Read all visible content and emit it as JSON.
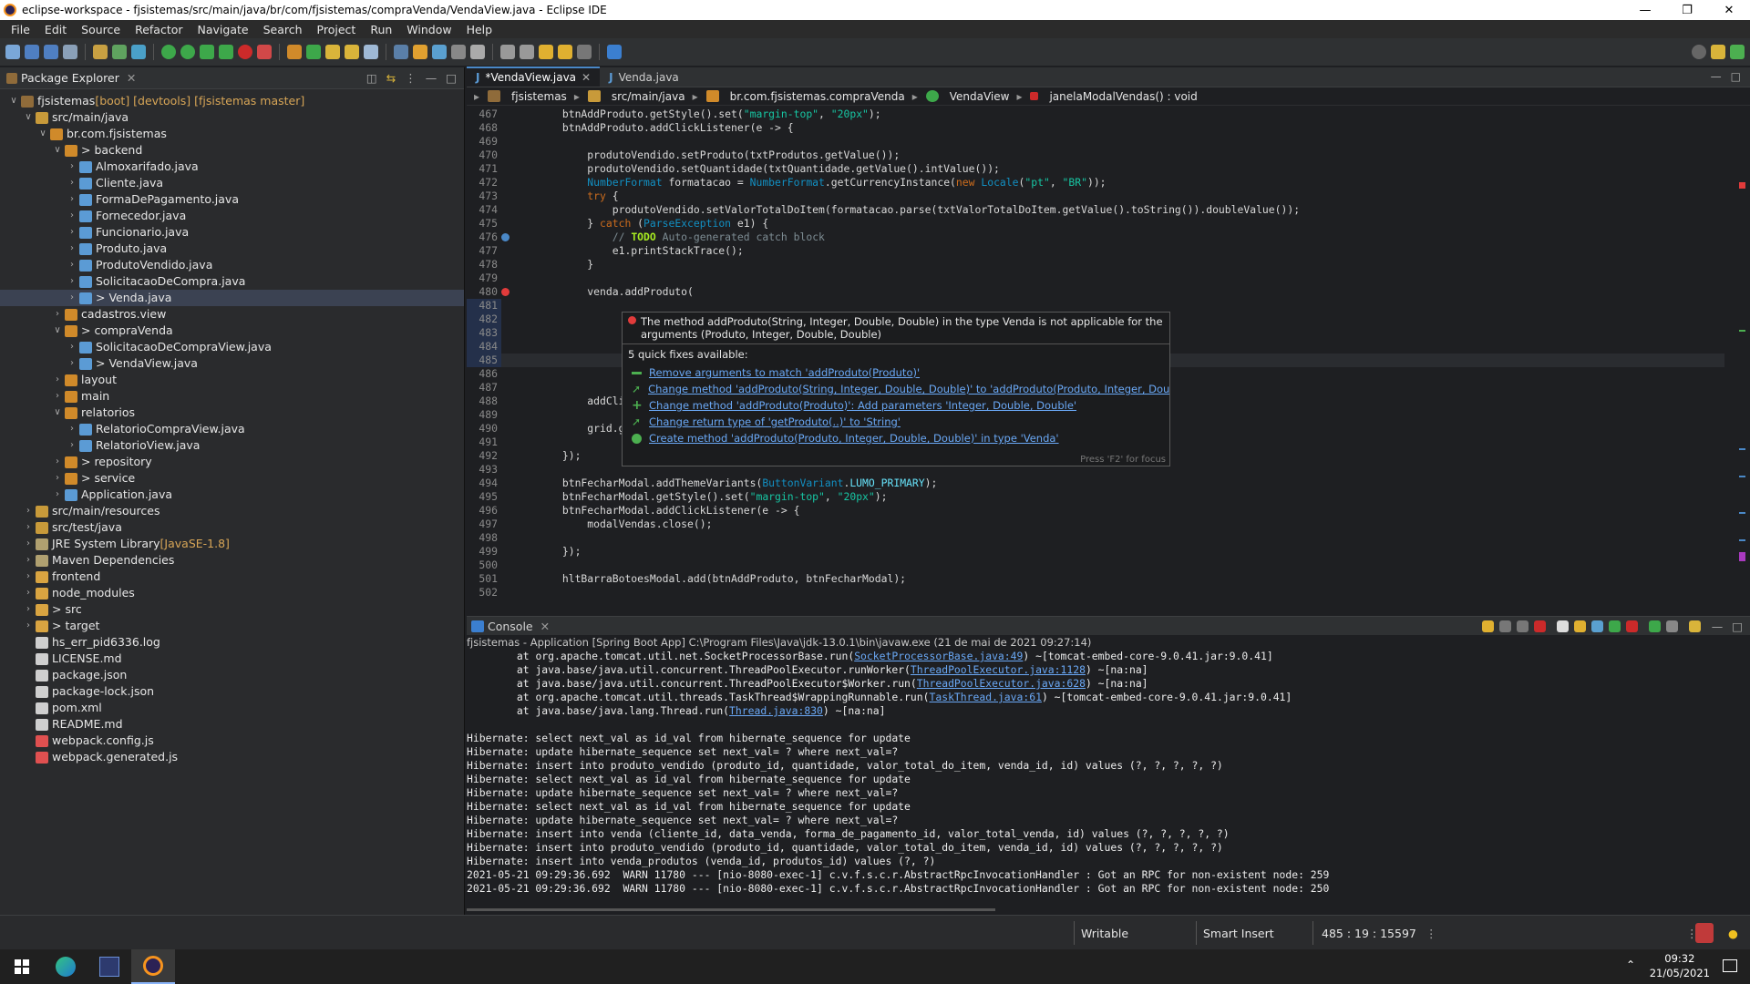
{
  "window": {
    "title": "eclipse-workspace - fjsistemas/src/main/java/br/com/fjsistemas/compraVenda/VendaView.java - Eclipse IDE"
  },
  "menu": [
    "File",
    "Edit",
    "Source",
    "Refactor",
    "Navigate",
    "Search",
    "Project",
    "Run",
    "Window",
    "Help"
  ],
  "explorer": {
    "title": "Package Explorer",
    "rows": [
      {
        "indent": 0,
        "arrow": "v",
        "icon": "project",
        "label": "fjsistemas",
        "deco": " [boot] [devtools] [fjsistemas master]"
      },
      {
        "indent": 1,
        "arrow": "v",
        "icon": "srcfolder",
        "label": "src/main/java",
        "deco": ""
      },
      {
        "indent": 2,
        "arrow": "v",
        "icon": "package",
        "label": "br.com.fjsistemas",
        "deco": ""
      },
      {
        "indent": 3,
        "arrow": "v",
        "icon": "package",
        "label": "> backend",
        "deco": ""
      },
      {
        "indent": 4,
        "arrow": ">",
        "icon": "java",
        "label": "Almoxarifado.java",
        "deco": ""
      },
      {
        "indent": 4,
        "arrow": ">",
        "icon": "java",
        "label": "Cliente.java",
        "deco": ""
      },
      {
        "indent": 4,
        "arrow": ">",
        "icon": "java",
        "label": "FormaDePagamento.java",
        "deco": ""
      },
      {
        "indent": 4,
        "arrow": ">",
        "icon": "java",
        "label": "Fornecedor.java",
        "deco": ""
      },
      {
        "indent": 4,
        "arrow": ">",
        "icon": "java",
        "label": "Funcionario.java",
        "deco": ""
      },
      {
        "indent": 4,
        "arrow": ">",
        "icon": "java",
        "label": "Produto.java",
        "deco": ""
      },
      {
        "indent": 4,
        "arrow": ">",
        "icon": "java",
        "label": "ProdutoVendido.java",
        "deco": ""
      },
      {
        "indent": 4,
        "arrow": ">",
        "icon": "java",
        "label": "SolicitacaoDeCompra.java",
        "deco": ""
      },
      {
        "indent": 4,
        "arrow": ">",
        "icon": "java",
        "label": "> Venda.java",
        "deco": "",
        "selected": true
      },
      {
        "indent": 3,
        "arrow": ">",
        "icon": "package",
        "label": "cadastros.view",
        "deco": ""
      },
      {
        "indent": 3,
        "arrow": "v",
        "icon": "package",
        "label": "> compraVenda",
        "deco": ""
      },
      {
        "indent": 4,
        "arrow": ">",
        "icon": "java",
        "label": "SolicitacaoDeCompraView.java",
        "deco": ""
      },
      {
        "indent": 4,
        "arrow": ">",
        "icon": "java",
        "label": "> VendaView.java",
        "deco": ""
      },
      {
        "indent": 3,
        "arrow": ">",
        "icon": "package",
        "label": "layout",
        "deco": ""
      },
      {
        "indent": 3,
        "arrow": ">",
        "icon": "package",
        "label": "main",
        "deco": ""
      },
      {
        "indent": 3,
        "arrow": "v",
        "icon": "package",
        "label": "relatorios",
        "deco": ""
      },
      {
        "indent": 4,
        "arrow": ">",
        "icon": "java",
        "label": "RelatorioCompraView.java",
        "deco": ""
      },
      {
        "indent": 4,
        "arrow": ">",
        "icon": "java",
        "label": "RelatorioView.java",
        "deco": ""
      },
      {
        "indent": 3,
        "arrow": ">",
        "icon": "package",
        "label": "> repository",
        "deco": ""
      },
      {
        "indent": 3,
        "arrow": ">",
        "icon": "package",
        "label": "> service",
        "deco": ""
      },
      {
        "indent": 3,
        "arrow": ">",
        "icon": "java",
        "label": "Application.java",
        "deco": ""
      },
      {
        "indent": 1,
        "arrow": ">",
        "icon": "srcfolder",
        "label": "src/main/resources",
        "deco": ""
      },
      {
        "indent": 1,
        "arrow": ">",
        "icon": "srcfolder",
        "label": "src/test/java",
        "deco": ""
      },
      {
        "indent": 1,
        "arrow": ">",
        "icon": "library",
        "label": "JRE System Library",
        "deco": " [JavaSE-1.8]"
      },
      {
        "indent": 1,
        "arrow": ">",
        "icon": "library",
        "label": "Maven Dependencies",
        "deco": ""
      },
      {
        "indent": 1,
        "arrow": ">",
        "icon": "folder",
        "label": "frontend",
        "deco": ""
      },
      {
        "indent": 1,
        "arrow": ">",
        "icon": "folder",
        "label": "node_modules",
        "deco": ""
      },
      {
        "indent": 1,
        "arrow": ">",
        "icon": "folder",
        "label": "> src",
        "deco": ""
      },
      {
        "indent": 1,
        "arrow": ">",
        "icon": "folder",
        "label": "> target",
        "deco": ""
      },
      {
        "indent": 1,
        "arrow": "",
        "icon": "file",
        "label": "hs_err_pid6336.log",
        "deco": ""
      },
      {
        "indent": 1,
        "arrow": "",
        "icon": "file",
        "label": "LICENSE.md",
        "deco": ""
      },
      {
        "indent": 1,
        "arrow": "",
        "icon": "file",
        "label": "package.json",
        "deco": ""
      },
      {
        "indent": 1,
        "arrow": "",
        "icon": "file",
        "label": "package-lock.json",
        "deco": ""
      },
      {
        "indent": 1,
        "arrow": "",
        "icon": "file",
        "label": "pom.xml",
        "deco": ""
      },
      {
        "indent": 1,
        "arrow": "",
        "icon": "file",
        "label": "README.md",
        "deco": ""
      },
      {
        "indent": 1,
        "arrow": "",
        "icon": "webfile",
        "label": "webpack.config.js",
        "deco": ""
      },
      {
        "indent": 1,
        "arrow": "",
        "icon": "webfile",
        "label": "webpack.generated.js",
        "deco": ""
      }
    ]
  },
  "editor": {
    "tabs": [
      {
        "label": "*VendaView.java",
        "active": true
      },
      {
        "label": "Venda.java",
        "active": false
      }
    ],
    "breadcrumb": [
      "fjsistemas",
      "src/main/java",
      "br.com.fjsistemas.compraVenda",
      "VendaView",
      "janelaModalVendas() : void"
    ],
    "lines": [
      {
        "n": "467",
        "t": "        btnAddProduto.getStyle().set(\"margin-top\", \"20px\");"
      },
      {
        "n": "468",
        "t": "        btnAddProduto.addClickListener(e -> {"
      },
      {
        "n": "469",
        "t": ""
      },
      {
        "n": "470",
        "t": "            produtoVendido.setProduto(txtProdutos.getValue());"
      },
      {
        "n": "471",
        "t": "            produtoVendido.setQuantidade(txtQuantidade.getValue().intValue());"
      },
      {
        "n": "472",
        "t": "            NumberFormat formatacao = NumberFormat.getCurrencyInstance(new Locale(\"pt\", \"BR\"));"
      },
      {
        "n": "473",
        "t": "            try {"
      },
      {
        "n": "474",
        "t": "                produtoVendido.setValorTotalDoItem(formatacao.parse(txtValorTotalDoItem.getValue().toString()).doubleValue());"
      },
      {
        "n": "475",
        "t": "            } catch (ParseException e1) {"
      },
      {
        "n": "476",
        "t": "                // TODO Auto-generated catch block"
      },
      {
        "n": "477",
        "t": "                e1.printStackTrace();"
      },
      {
        "n": "478",
        "t": "            }"
      },
      {
        "n": "479",
        "t": ""
      },
      {
        "n": "480",
        "t": "            venda.addProduto("
      },
      {
        "n": "481",
        "t": ""
      },
      {
        "n": "482",
        "t": ""
      },
      {
        "n": "483",
        "t": ""
      },
      {
        "n": "484",
        "t": ""
      },
      {
        "n": "485",
        "t": "                    );"
      },
      {
        "n": "486",
        "t": ""
      },
      {
        "n": "487",
        "t": ""
      },
      {
        "n": "488",
        "t": "            addCli"
      },
      {
        "n": "489",
        "t": ""
      },
      {
        "n": "490",
        "t": "            grid.g"
      },
      {
        "n": "491",
        "t": ""
      },
      {
        "n": "492",
        "t": "        });"
      },
      {
        "n": "493",
        "t": ""
      },
      {
        "n": "494",
        "t": "        btnFecharModal.addThemeVariants(ButtonVariant.LUMO_PRIMARY);"
      },
      {
        "n": "495",
        "t": "        btnFecharModal.getStyle().set(\"margin-top\", \"20px\");"
      },
      {
        "n": "496",
        "t": "        btnFecharModal.addClickListener(e -> {"
      },
      {
        "n": "497",
        "t": "            modalVendas.close();"
      },
      {
        "n": "498",
        "t": ""
      },
      {
        "n": "499",
        "t": "        });"
      },
      {
        "n": "500",
        "t": ""
      },
      {
        "n": "501",
        "t": "        hltBarraBotoesModal.add(btnAddProduto, btnFecharModal);"
      },
      {
        "n": "502",
        "t": ""
      }
    ]
  },
  "popup": {
    "message": "The method addProduto(String, Integer, Double, Double) in the type Venda is not applicable for the arguments (Produto, Integer, Double, Double)",
    "header": "5 quick fixes available:",
    "fixes": [
      {
        "icon": "remove",
        "label": "Remove arguments to match 'addProduto(Produto)'"
      },
      {
        "icon": "change",
        "label": "Change method 'addProduto(String, Integer, Double, Double)' to 'addProduto(Produto, Integer, Double, Double)'"
      },
      {
        "icon": "add",
        "label": "Change method 'addProduto(Produto)': Add parameters 'Integer, Double, Double'"
      },
      {
        "icon": "change",
        "label": "Change return type of 'getProduto(..)' to 'String'"
      },
      {
        "icon": "create",
        "label": "Create method 'addProduto(Produto, Integer, Double, Double)' in type 'Venda'"
      }
    ],
    "footer": "Press 'F2' for focus"
  },
  "console": {
    "title": "Console",
    "description": "fjsistemas - Application [Spring Boot App] C:\\Program Files\\Java\\jdk-13.0.1\\bin\\javaw.exe  (21 de mai de 2021 09:27:14)",
    "lines": [
      {
        "pre": "\tat org.apache.tomcat.util.net.SocketProcessorBase.run(",
        "link": "SocketProcessorBase.java:49",
        "post": ") ~[tomcat-embed-core-9.0.41.jar:9.0.41]"
      },
      {
        "pre": "\tat java.base/java.util.concurrent.ThreadPoolExecutor.runWorker(",
        "link": "ThreadPoolExecutor.java:1128",
        "post": ") ~[na:na]"
      },
      {
        "pre": "\tat java.base/java.util.concurrent.ThreadPoolExecutor$Worker.run(",
        "link": "ThreadPoolExecutor.java:628",
        "post": ") ~[na:na]"
      },
      {
        "pre": "\tat org.apache.tomcat.util.threads.TaskThread$WrappingRunnable.run(",
        "link": "TaskThread.java:61",
        "post": ") ~[tomcat-embed-core-9.0.41.jar:9.0.41]"
      },
      {
        "pre": "\tat java.base/java.lang.Thread.run(",
        "link": "Thread.java:830",
        "post": ") ~[na:na]"
      },
      {
        "pre": "",
        "link": "",
        "post": ""
      },
      {
        "pre": "Hibernate: select next_val as id_val from hibernate_sequence for update",
        "link": "",
        "post": ""
      },
      {
        "pre": "Hibernate: update hibernate_sequence set next_val= ? where next_val=?",
        "link": "",
        "post": ""
      },
      {
        "pre": "Hibernate: insert into produto_vendido (produto_id, quantidade, valor_total_do_item, venda_id, id) values (?, ?, ?, ?, ?)",
        "link": "",
        "post": ""
      },
      {
        "pre": "Hibernate: select next_val as id_val from hibernate_sequence for update",
        "link": "",
        "post": ""
      },
      {
        "pre": "Hibernate: update hibernate_sequence set next_val= ? where next_val=?",
        "link": "",
        "post": ""
      },
      {
        "pre": "Hibernate: select next_val as id_val from hibernate_sequence for update",
        "link": "",
        "post": ""
      },
      {
        "pre": "Hibernate: update hibernate_sequence set next_val= ? where next_val=?",
        "link": "",
        "post": ""
      },
      {
        "pre": "Hibernate: insert into venda (cliente_id, data_venda, forma_de_pagamento_id, valor_total_venda, id) values (?, ?, ?, ?, ?)",
        "link": "",
        "post": ""
      },
      {
        "pre": "Hibernate: insert into produto_vendido (produto_id, quantidade, valor_total_do_item, venda_id, id) values (?, ?, ?, ?, ?)",
        "link": "",
        "post": ""
      },
      {
        "pre": "Hibernate: insert into venda_produtos (venda_id, produtos_id) values (?, ?)",
        "link": "",
        "post": ""
      },
      {
        "pre": "2021-05-21 09:29:36.692  WARN 11780 --- [nio-8080-exec-1] c.v.f.s.c.r.AbstractRpcInvocationHandler : Got an RPC for non-existent node: 259",
        "link": "",
        "post": ""
      },
      {
        "pre": "2021-05-21 09:29:36.692  WARN 11780 --- [nio-8080-exec-1] c.v.f.s.c.r.AbstractRpcInvocationHandler : Got an RPC for non-existent node: 250",
        "link": "",
        "post": ""
      }
    ]
  },
  "status": {
    "writable": "Writable",
    "insert_mode": "Smart Insert",
    "position": "485 : 19 : 15597"
  },
  "taskbar": {
    "time": "09:32",
    "date": "21/05/2021"
  },
  "colors": {
    "accent": "#4a88c7",
    "error": "#e13b3b",
    "link": "#6aa8f5",
    "background": "#1e1f22"
  }
}
